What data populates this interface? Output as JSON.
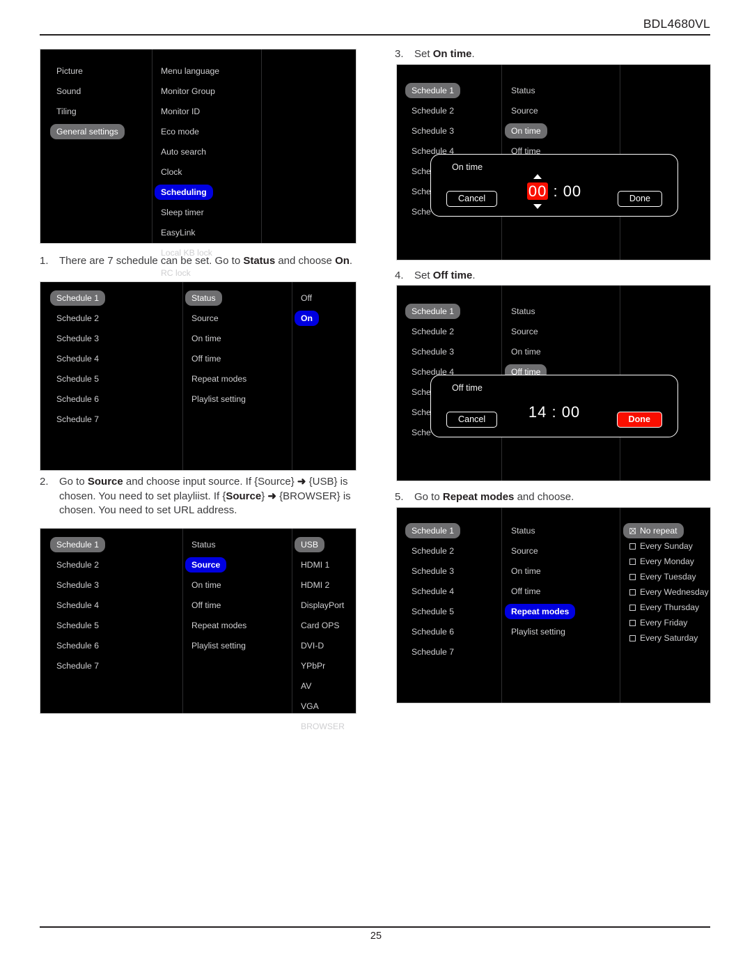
{
  "document": {
    "header_model": "BDL4680VL",
    "page_number": "25"
  },
  "steps": {
    "s1": {
      "num": "1.",
      "pre": "There are 7 schedule can be set. Go to ",
      "b1": "Status",
      "mid": " and choose ",
      "b2": "On",
      "post": "."
    },
    "s2": {
      "num": "2.",
      "pre": "Go to ",
      "b1": "Source",
      "l1b": " and choose input source. If {Source} ",
      "arrow1": "➜",
      "l1c": " {USB}",
      "l2a": "is chosen. You need to set playliist. If {",
      "b2": "Source",
      "l2b": "} ",
      "arrow2": "➜",
      "l2c": " {BROWSER} is",
      "l3": "chosen. You need to set URL address."
    },
    "s3": {
      "num": "3.",
      "pre": "Set ",
      "b1": "On time",
      "post": "."
    },
    "s4": {
      "num": "4.",
      "pre": "Set ",
      "b1": "Off time",
      "post": "."
    },
    "s5": {
      "num": "5.",
      "pre": "Go to ",
      "b1": "Repeat modes",
      "post": " and choose."
    }
  },
  "panel_settings": {
    "left_column": [
      "Picture",
      "Sound",
      "Tiling",
      "General settings"
    ],
    "left_selected_index": 3,
    "middle_column": [
      "Menu language",
      "Monitor Group",
      "Monitor ID",
      "Eco mode",
      "Auto search",
      "Clock",
      "Scheduling",
      "Sleep timer",
      "EasyLink",
      "Local KB lock",
      "RC lock"
    ],
    "middle_selected_index": 6,
    "scroll_icon": "chevron-down-icon"
  },
  "schedules": [
    "Schedule 1",
    "Schedule 2",
    "Schedule 3",
    "Schedule 4",
    "Schedule 5",
    "Schedule 6",
    "Schedule 7"
  ],
  "schedule_fields": [
    "Status",
    "Source",
    "On time",
    "Off time",
    "Repeat modes",
    "Playlist setting"
  ],
  "panel_status": {
    "selected_schedule": 0,
    "selected_field": 0,
    "options": [
      "Off",
      "On"
    ],
    "selected_option": 1
  },
  "panel_source": {
    "selected_schedule": 0,
    "selected_field": 1,
    "options": [
      "USB",
      "HDMI 1",
      "HDMI 2",
      "DisplayPort",
      "Card OPS",
      "DVI-D",
      "YPbPr",
      "AV",
      "VGA",
      "BROWSER"
    ],
    "selected_option": 0
  },
  "panel_ontime": {
    "selected_schedule": 0,
    "selected_field": 2,
    "clipped_schedules": [
      "Sche",
      "Sche"
    ],
    "dialog": {
      "title": "On time",
      "hours": "00",
      "separator": ":",
      "minutes": "00",
      "cancel_label": "Cancel",
      "done_label": "Done",
      "hours_highlight_color": "#fa0f00",
      "spinner_up_icon": "caret-up-icon",
      "spinner_down_icon": "caret-down-icon"
    }
  },
  "panel_offtime": {
    "selected_schedule": 0,
    "selected_field": 3,
    "clipped_schedules": [
      "Sche",
      "Sche"
    ],
    "dialog": {
      "title": "Off time",
      "hours": "14",
      "separator": ":",
      "minutes": "00",
      "cancel_label": "Cancel",
      "done_label": "Done",
      "done_highlight_color": "#fa0f00"
    }
  },
  "panel_repeat": {
    "selected_schedule": 0,
    "selected_field": 4,
    "options": [
      {
        "label": "No repeat",
        "checked": true
      },
      {
        "label": "Every Sunday",
        "checked": false
      },
      {
        "label": "Every Monday",
        "checked": false
      },
      {
        "label": "Every Tuesday",
        "checked": false
      },
      {
        "label": "Every Wednesday",
        "checked": false
      },
      {
        "label": "Every Thursday",
        "checked": false
      },
      {
        "label": "Every Friday",
        "checked": false
      },
      {
        "label": "Every Saturday",
        "checked": false
      }
    ]
  },
  "colors": {
    "highlight_blue": "#0000e0",
    "highlight_grey": "#6e6e70",
    "accent_red": "#fa0f00",
    "panel_bg": "#000000"
  }
}
